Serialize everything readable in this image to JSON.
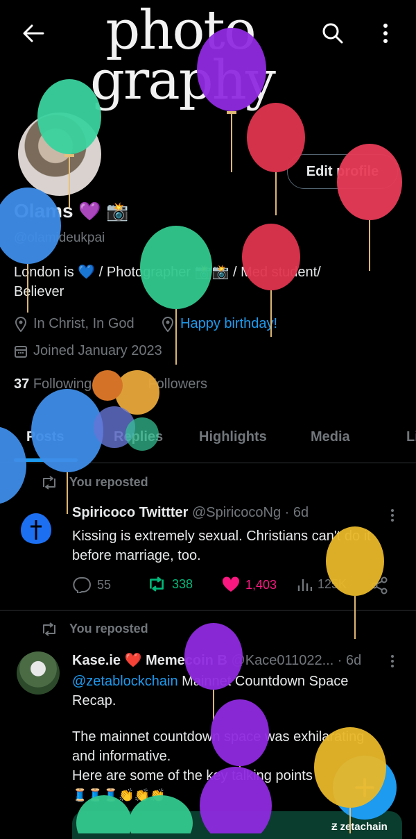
{
  "header": {
    "banner_text": "photo graphy",
    "icons": [
      "back-arrow-icon",
      "search-icon",
      "more-vertical-icon"
    ]
  },
  "profile": {
    "edit_label": "Edit profile",
    "name": "Olams",
    "name_emojis": "💜 📸",
    "handle": "@olamideukpai",
    "bio_line1": "London is 💙 / Photographer 📸📸 / Med student/",
    "bio_line2": "Believer",
    "location": "In Christ, In God",
    "website": "Happy birthday!",
    "joined": "Joined January 2023",
    "following_count": "37",
    "following_label": "Following",
    "followers_label": "Followers"
  },
  "tabs": [
    "Posts",
    "Replies",
    "Highlights",
    "Media",
    "Li"
  ],
  "posts": [
    {
      "repost_label": "You reposted",
      "author": "Spiricoco Twittter",
      "handle": "@SpiricocoNg · 6d",
      "text_line1": "Kissing is extremely sexual. Christians can't do it",
      "text_line2": "before marriage, too.",
      "replies": "55",
      "reposts": "338",
      "likes": "1,403",
      "views": "125K"
    },
    {
      "repost_label": "You reposted",
      "author": "Kase.ie ❤️ Memecoin B",
      "handle": "@Kace011022... · 6d",
      "mention": "@zetablockchain",
      "text_line1_rest": " Mainnet Countdown Space",
      "text_line2": "Recap.",
      "text_line3": "The mainnet countdown space was exhilarating",
      "text_line4": "and informative.",
      "text_line5": "Here are some of the key talking points",
      "emoji_row": "🧵🧵🧵👏👏👏",
      "card_label": "zetachain"
    }
  ],
  "colors": {
    "accent": "#1d9bf0",
    "repost_green": "#00ba7c",
    "like_pink": "#f91880",
    "muted": "#71767b"
  }
}
